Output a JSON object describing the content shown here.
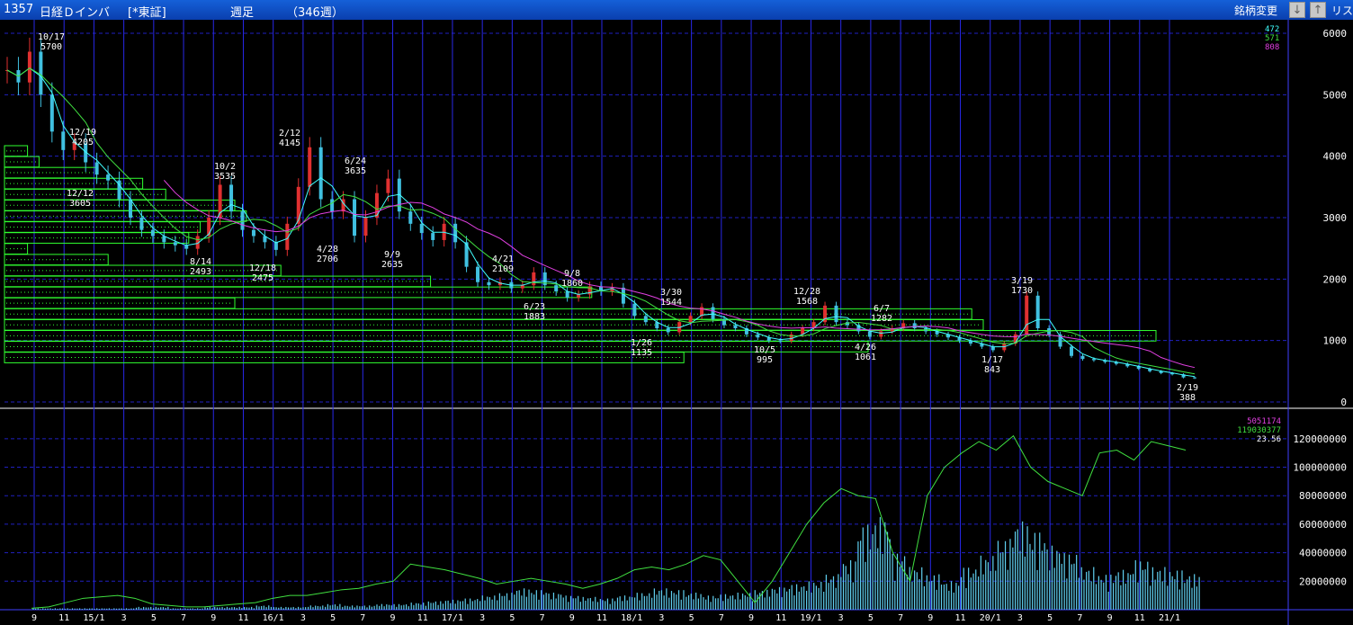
{
  "header": {
    "code": "1357",
    "name": "日経Ｄインバ",
    "market": "[*東証]",
    "period": "週足",
    "count": "（346週）",
    "change_button": "銘柄変更",
    "down_icon": "arrow-down-icon",
    "up_icon": "arrow-up-icon",
    "list_button": "リス"
  },
  "colors": {
    "background": "#000000",
    "grid_h": "#2020c0",
    "grid_v": "#2828e8",
    "up_candle": "#e03030",
    "down_candle": "#40c0e0",
    "ma_short": "#40ffff",
    "ma_mid": "#40e040",
    "ma_long": "#e040e0",
    "volume_bar": "#60d0f0",
    "volume_line": "#40e040",
    "profile": "#30ff30",
    "label": "#ffffff"
  },
  "chart_data": [
    {
      "type": "candlestick",
      "ylim": [
        0,
        6000
      ],
      "yticks": [
        "6000",
        "5000",
        "4000",
        "3000",
        "2000",
        "1000",
        "0"
      ],
      "legend": [
        "472",
        "571",
        "808"
      ],
      "xticks": [
        "9",
        "11",
        "15/1",
        "3",
        "5",
        "7",
        "9",
        "11",
        "16/1",
        "3",
        "5",
        "7",
        "9",
        "11",
        "17/1",
        "3",
        "5",
        "7",
        "9",
        "11",
        "18/1",
        "3",
        "5",
        "7",
        "9",
        "11",
        "19/1",
        "3",
        "5",
        "7",
        "9",
        "11",
        "20/1",
        "3",
        "5",
        "7",
        "9",
        "11",
        "21/1"
      ],
      "close_path": [
        5400,
        5200,
        5700,
        5000,
        4400,
        4100,
        4205,
        3900,
        3700,
        3605,
        3300,
        3000,
        2800,
        2700,
        2600,
        2550,
        2493,
        2700,
        3000,
        3535,
        3100,
        2800,
        2700,
        2600,
        2475,
        2900,
        3500,
        4145,
        3300,
        3100,
        3300,
        2706,
        3000,
        3400,
        3635,
        3100,
        2900,
        2750,
        2635,
        2900,
        2600,
        2200,
        1950,
        1900,
        1950,
        1850,
        1900,
        2109,
        1900,
        1800,
        1700,
        1750,
        1883,
        1800,
        1860,
        1600,
        1400,
        1300,
        1200,
        1135,
        1300,
        1400,
        1544,
        1350,
        1250,
        1200,
        1100,
        1050,
        1000,
        995,
        1100,
        1200,
        1300,
        1568,
        1300,
        1250,
        1150,
        1061,
        1150,
        1200,
        1282,
        1200,
        1150,
        1100,
        1050,
        1000,
        950,
        900,
        843,
        950,
        1100,
        1730,
        1200,
        1100,
        900,
        750,
        700,
        680,
        650,
        620,
        580,
        540,
        500,
        470,
        450,
        400,
        388
      ],
      "annotations": [
        {
          "date": "10/17",
          "value": "5700"
        },
        {
          "date": "12/19",
          "value": "4205"
        },
        {
          "date": "12/12",
          "value": "3605"
        },
        {
          "date": "8/14",
          "value": "2493"
        },
        {
          "date": "10/2",
          "value": "3535"
        },
        {
          "date": "12/18",
          "value": "2475"
        },
        {
          "date": "2/12",
          "value": "4145"
        },
        {
          "date": "4/28",
          "value": "2706"
        },
        {
          "date": "6/24",
          "value": "3635"
        },
        {
          "date": "9/9",
          "value": "2635"
        },
        {
          "date": "4/21",
          "value": "2109"
        },
        {
          "date": "6/23",
          "value": "1883"
        },
        {
          "date": "9/8",
          "value": "1860"
        },
        {
          "date": "1/26",
          "value": "1135"
        },
        {
          "date": "3/30",
          "value": "1544"
        },
        {
          "date": "10/5",
          "value": "995"
        },
        {
          "date": "12/28",
          "value": "1568"
        },
        {
          "date": "4/26",
          "value": "1061"
        },
        {
          "date": "6/7",
          "value": "1282"
        },
        {
          "date": "1/17",
          "value": "843"
        },
        {
          "date": "3/19",
          "value": "1730"
        },
        {
          "date": "2/19",
          "value": "388"
        }
      ],
      "volume_profile_k": [
        2,
        3,
        8,
        12,
        14,
        20,
        21,
        17,
        16,
        2,
        9,
        24,
        37,
        51,
        20,
        84,
        85,
        100,
        75,
        59
      ]
    },
    {
      "type": "bar",
      "ylim": [
        0,
        130000000
      ],
      "yticks": [
        "120000000",
        "100000000",
        "80000000",
        "60000000",
        "40000000",
        "20000000"
      ],
      "legend": [
        "5051174",
        "119030377",
        "23.56"
      ],
      "volume_m": [
        1,
        1,
        1,
        1,
        1,
        1,
        2,
        2,
        1,
        1,
        2,
        2,
        2,
        3,
        2,
        2,
        3,
        4,
        3,
        3,
        4,
        4,
        5,
        6,
        7,
        8,
        10,
        12,
        15,
        14,
        12,
        10,
        9,
        8,
        10,
        12,
        15,
        14,
        12,
        10,
        11,
        12,
        14,
        16,
        18,
        20,
        25,
        35,
        60,
        65,
        40,
        30,
        25,
        20,
        30,
        38,
        50,
        62,
        55,
        45,
        40,
        30,
        25,
        28,
        35,
        30,
        28,
        25
      ],
      "avg_line_m": [
        1,
        2,
        5,
        8,
        9,
        10,
        8,
        4,
        3,
        2,
        2,
        3,
        4,
        5,
        8,
        10,
        10,
        12,
        14,
        15,
        18,
        20,
        32,
        30,
        28,
        25,
        22,
        18,
        20,
        22,
        20,
        18,
        15,
        18,
        22,
        28,
        30,
        28,
        32,
        38,
        35,
        20,
        5,
        20,
        40,
        60,
        75,
        85,
        80,
        78,
        40,
        20,
        80,
        100,
        110,
        118,
        112,
        122,
        100,
        90,
        85,
        80,
        110,
        112,
        105,
        118,
        115,
        112
      ]
    }
  ]
}
